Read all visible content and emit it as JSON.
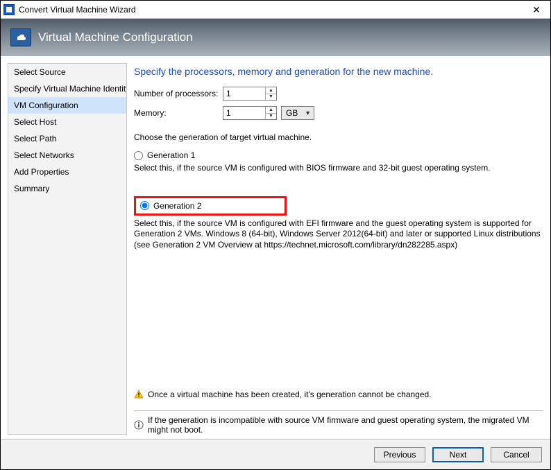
{
  "window": {
    "title": "Convert Virtual Machine Wizard"
  },
  "banner": {
    "title": "Virtual Machine Configuration"
  },
  "sidebar": {
    "items": [
      {
        "label": "Select Source"
      },
      {
        "label": "Specify Virtual Machine Identity"
      },
      {
        "label": "VM Configuration"
      },
      {
        "label": "Select Host"
      },
      {
        "label": "Select Path"
      },
      {
        "label": "Select Networks"
      },
      {
        "label": "Add Properties"
      },
      {
        "label": "Summary"
      }
    ],
    "selected_index": 2
  },
  "main": {
    "heading": "Specify the processors, memory and generation for the new machine.",
    "processors_label": "Number of processors:",
    "processors_value": "1",
    "memory_label": "Memory:",
    "memory_value": "1",
    "memory_unit": "GB",
    "generation_intro": "Choose the generation of target virtual machine.",
    "gen1_label": "Generation 1",
    "gen1_desc": "Select this, if the source VM is configured with BIOS firmware and 32-bit guest operating system.",
    "gen2_label": "Generation 2",
    "gen2_desc": "Select this, if the source VM is configured with EFI firmware and the guest operating system is supported for Generation 2 VMs. Windows 8 (64-bit), Windows Server 2012(64-bit) and later or supported Linux distributions (see Generation 2 VM Overview at https://technet.microsoft.com/library/dn282285.aspx)",
    "selected_generation": "gen2",
    "warning_text": "Once a virtual machine has been created, it's generation cannot be changed.",
    "info_text": "If the generation is incompatible with source VM firmware and guest operating system, the migrated VM might not boot."
  },
  "footer": {
    "previous": "Previous",
    "next": "Next",
    "cancel": "Cancel"
  }
}
